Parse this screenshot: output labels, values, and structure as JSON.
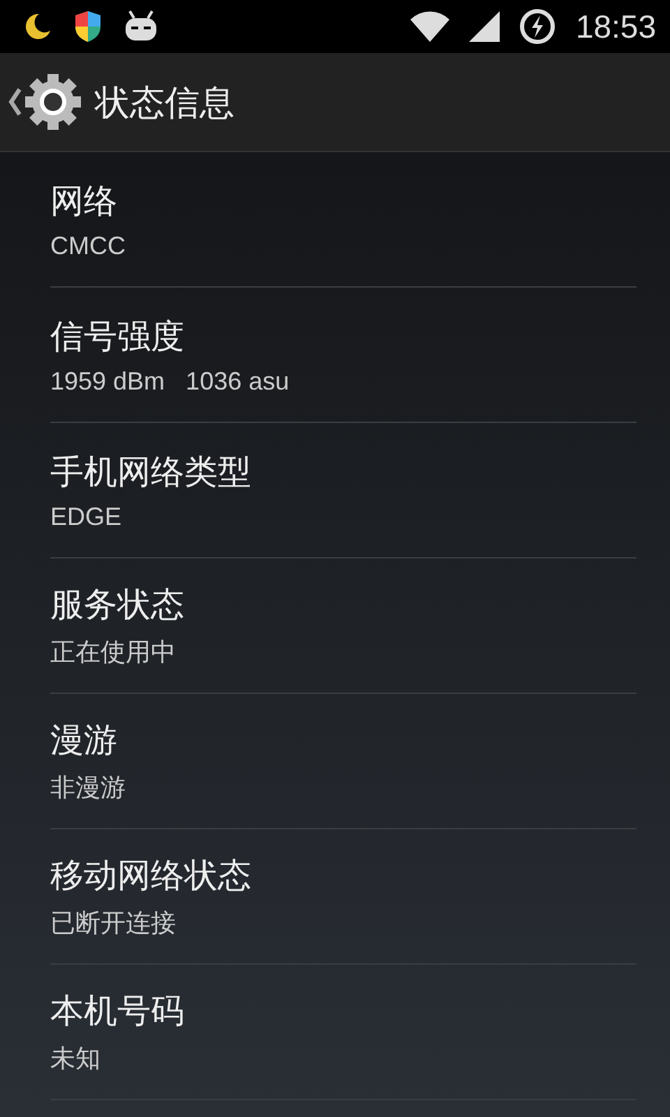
{
  "status_bar": {
    "time": "18:53"
  },
  "action_bar": {
    "title": "状态信息"
  },
  "items": [
    {
      "title": "网络",
      "summary": "CMCC"
    },
    {
      "title": "信号强度",
      "summary": "1959 dBm   1036 asu"
    },
    {
      "title": "手机网络类型",
      "summary": "EDGE"
    },
    {
      "title": "服务状态",
      "summary": "正在使用中"
    },
    {
      "title": "漫游",
      "summary": "非漫游"
    },
    {
      "title": "移动网络状态",
      "summary": "已断开连接"
    },
    {
      "title": "本机号码",
      "summary": "未知"
    }
  ]
}
